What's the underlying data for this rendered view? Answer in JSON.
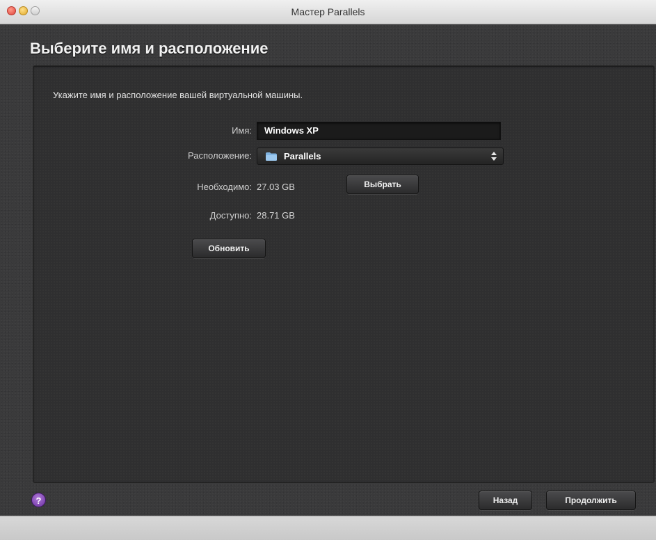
{
  "window": {
    "title": "Мастер Parallels"
  },
  "page": {
    "heading": "Выберите имя и расположение",
    "intro": "Укажите имя и расположение вашей виртуальной машины."
  },
  "form": {
    "name_label": "Имя:",
    "name_value": "Windows XP",
    "location_label": "Расположение:",
    "location_value": "Parallels",
    "required_label": "Необходимо:",
    "required_value": "27.03 GB",
    "available_label": "Доступно:",
    "available_value": "28.71 GB",
    "choose_button": "Выбрать",
    "refresh_button": "Обновить"
  },
  "footer": {
    "help_label": "?",
    "back_button": "Назад",
    "continue_button": "Продолжить"
  },
  "colors": {
    "background": "#3a3a3b",
    "panel": "#2f2f30",
    "help": "#8a4cc0"
  },
  "icons": [
    "folder-icon",
    "updown-arrows-icon",
    "help-icon"
  ]
}
